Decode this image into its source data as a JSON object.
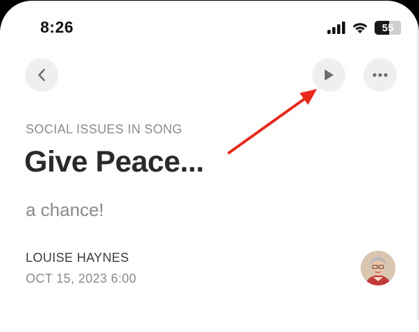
{
  "status_bar": {
    "time": "8:26",
    "battery_percent": "55",
    "battery_level": 0.55,
    "icons": [
      "signal-icon",
      "wifi-icon",
      "battery-icon"
    ]
  },
  "toolbar": {
    "back_icon": "chevron-left-icon",
    "play_icon": "play-icon",
    "more_icon": "ellipsis-icon"
  },
  "post": {
    "category": "SOCIAL ISSUES IN SONG",
    "title": "Give Peace...",
    "subtitle": "a chance!",
    "author": "LOUISE HAYNES",
    "date": "OCT 15, 2023 6:00"
  },
  "annotation": {
    "color": "#e8291c",
    "points_to": "play-button"
  },
  "colors": {
    "background": "#ffffff",
    "button_bg": "#efefef",
    "icon": "#6e6e6e",
    "title": "#2a2a2a",
    "muted": "#8a8a8a"
  }
}
